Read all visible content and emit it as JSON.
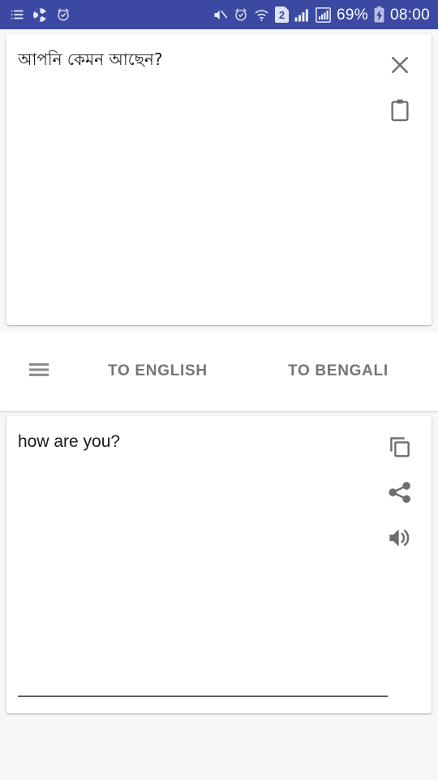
{
  "status_bar": {
    "background_color": "#3b49a3",
    "left_icons": [
      {
        "name": "list-icon",
        "glyph": "list"
      },
      {
        "name": "camera-aperture-icon",
        "glyph": "aperture"
      },
      {
        "name": "alarm-clock-icon",
        "glyph": "alarm"
      }
    ],
    "right_icons": [
      {
        "name": "mute-icon",
        "glyph": "mute"
      },
      {
        "name": "alarm-clock-icon",
        "glyph": "alarm"
      },
      {
        "name": "wifi-icon",
        "glyph": "wifi"
      },
      {
        "name": "sim-card-icon",
        "glyph": "sim",
        "label": "2"
      },
      {
        "name": "signal-bars-icon",
        "glyph": "signal"
      },
      {
        "name": "signal-boxed-icon",
        "glyph": "signal-boxed"
      }
    ],
    "battery_percent": "69%",
    "battery_charging": true,
    "clock": "08:00"
  },
  "source_card": {
    "text": "আপনি কেমন আছেন?",
    "underline_color": "#e5467f",
    "actions": [
      {
        "name": "clear-button",
        "icon": "close-icon"
      },
      {
        "name": "paste-button",
        "icon": "clipboard-icon"
      }
    ]
  },
  "middle_bar": {
    "menu_label": "menu-icon",
    "to_english_label": "TO ENGLISH",
    "to_bengali_label": "TO BENGALI",
    "label_color": "#757575"
  },
  "target_card": {
    "text": "how are you?",
    "underline_color": "#5e5e5e",
    "actions": [
      {
        "name": "copy-button",
        "icon": "copy-icon"
      },
      {
        "name": "share-button",
        "icon": "share-icon"
      },
      {
        "name": "speak-button",
        "icon": "speaker-icon"
      }
    ]
  }
}
